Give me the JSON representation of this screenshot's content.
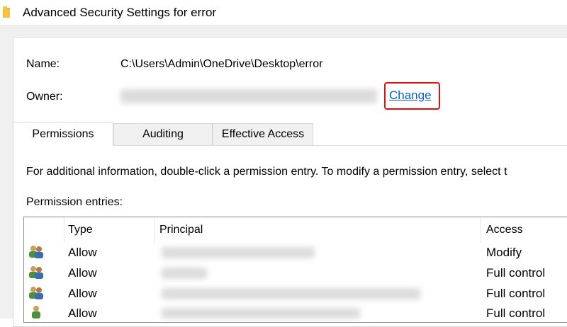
{
  "window": {
    "title": "Advanced Security Settings for error",
    "icon": "folder-icon"
  },
  "details": {
    "name_label": "Name:",
    "name_value": "C:\\Users\\Admin\\OneDrive\\Desktop\\error",
    "owner_label": "Owner:",
    "change_link": "Change"
  },
  "tabs": [
    {
      "label": "Permissions",
      "active": true
    },
    {
      "label": "Auditing",
      "active": false
    },
    {
      "label": "Effective Access",
      "active": false
    }
  ],
  "permissions": {
    "info_text": "For additional information, double-click a permission entry. To modify a permission entry, select t",
    "entries_label": "Permission entries:",
    "columns": {
      "type": "Type",
      "principal": "Principal",
      "access": "Access"
    },
    "rows": [
      {
        "type": "Allow",
        "access": "Modify",
        "icon": "user-group-icon"
      },
      {
        "type": "Allow",
        "access": "Full control",
        "icon": "user-group-icon"
      },
      {
        "type": "Allow",
        "access": "Full control",
        "icon": "user-group-icon"
      },
      {
        "type": "Allow",
        "access": "Full control",
        "icon": "user-icon"
      }
    ]
  },
  "colors": {
    "link": "#0a5ec2",
    "highlight": "#e01010",
    "folder": "#f5c542"
  }
}
